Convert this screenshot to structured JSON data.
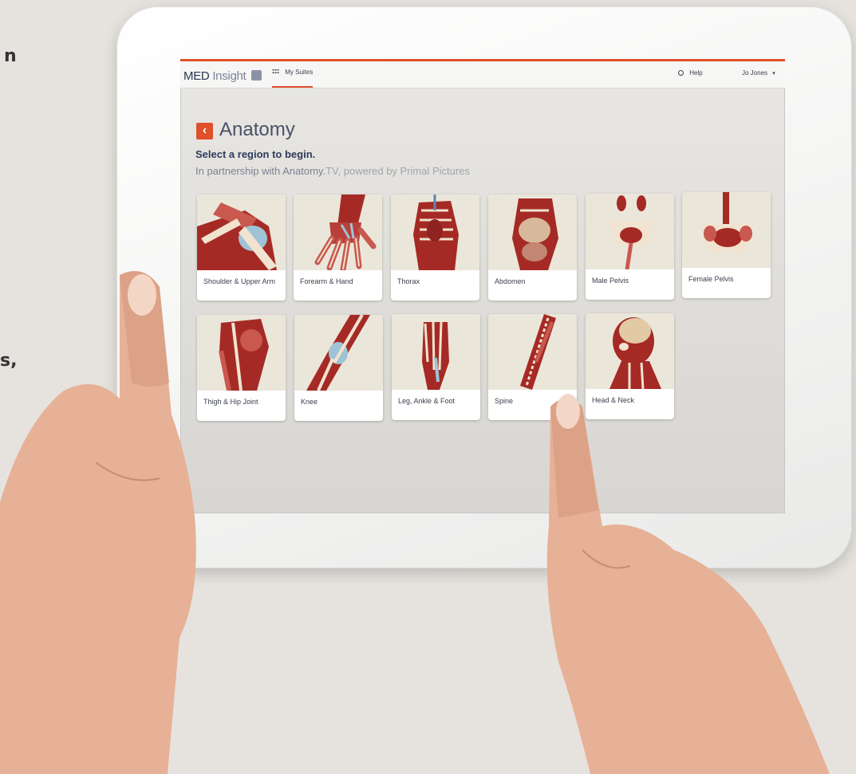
{
  "edge_glyphs": {
    "top": "n",
    "middle": "s,"
  },
  "app": {
    "logo_main": "MED",
    "logo_sub": "Insight",
    "logo_badge": "tv",
    "nav_suites": "My Suites",
    "help": "Help",
    "user": "Jo Jones",
    "user_caret": "▾"
  },
  "page": {
    "back_glyph": "‹",
    "title": "Anatomy",
    "subtitle": "Select a region to begin.",
    "partner_prefix": "In partnership with Anatomy.",
    "partner_rest": "TV, powered by Primal Pictures"
  },
  "regions": [
    {
      "label": "Shoulder & Upper Arm"
    },
    {
      "label": "Forearm & Hand"
    },
    {
      "label": "Thorax"
    },
    {
      "label": "Abdomen"
    },
    {
      "label": "Male Pelvis"
    },
    {
      "label": "Female Pelvis"
    },
    {
      "label": "Thigh & Hip Joint"
    },
    {
      "label": "Knee"
    },
    {
      "label": "Leg, Ankle & Foot"
    },
    {
      "label": "Spine"
    },
    {
      "label": "Head & Neck"
    }
  ],
  "colors": {
    "accent": "#e0502a",
    "muscle": "#a52a25",
    "bone": "#f1e3cf",
    "skin": "#e8b49a"
  }
}
